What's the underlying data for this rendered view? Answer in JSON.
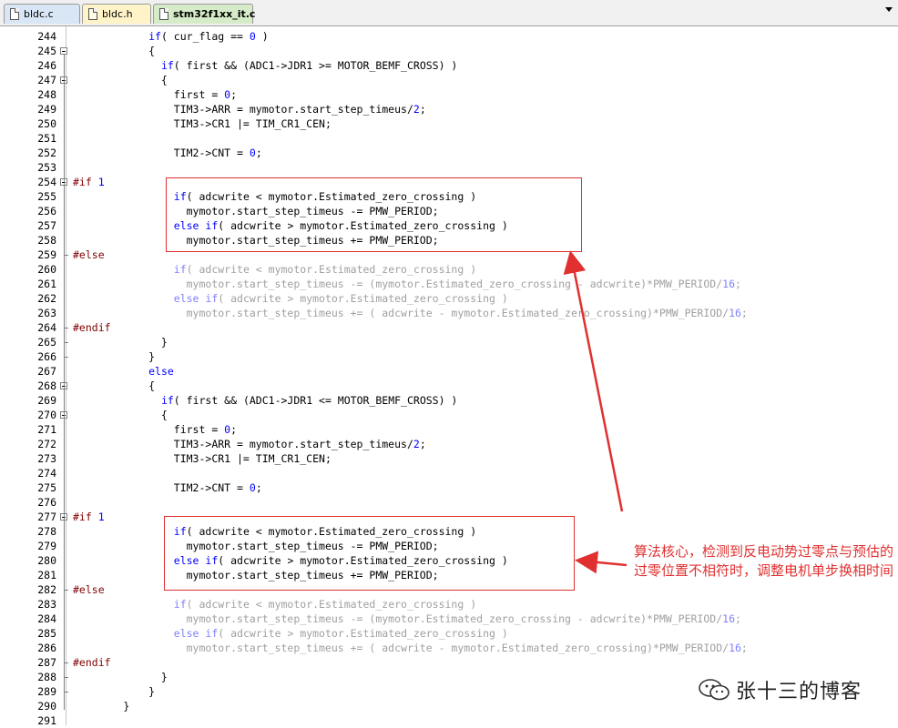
{
  "tabs": [
    {
      "label": "bldc.c",
      "active": false
    },
    {
      "label": "bldc.h",
      "active": false
    },
    {
      "label": "stm32f1xx_it.c",
      "active": true
    }
  ],
  "colors": {
    "keyword": "#0000ff",
    "preprocessor": "#800000",
    "inactive_code": "#a0a0a0",
    "annotation": "#e03030"
  },
  "lines": [
    {
      "n": "244",
      "text": "            if( cur_flag == 0 )"
    },
    {
      "n": "245",
      "text": "            {"
    },
    {
      "n": "246",
      "text": "              if( first && (ADC1->JDR1 >= MOTOR_BEMF_CROSS) )"
    },
    {
      "n": "247",
      "text": "              {"
    },
    {
      "n": "248",
      "text": "                first = 0;"
    },
    {
      "n": "249",
      "text": "                TIM3->ARR = mymotor.start_step_timeus/2;"
    },
    {
      "n": "250",
      "text": "                TIM3->CR1 |= TIM_CR1_CEN;"
    },
    {
      "n": "251",
      "text": ""
    },
    {
      "n": "252",
      "text": "                TIM2->CNT = 0;"
    },
    {
      "n": "253",
      "text": ""
    },
    {
      "n": "254",
      "text": "#if 1"
    },
    {
      "n": "255",
      "text": "                if( adcwrite < mymotor.Estimated_zero_crossing )"
    },
    {
      "n": "256",
      "text": "                  mymotor.start_step_timeus -= PMW_PERIOD;"
    },
    {
      "n": "257",
      "text": "                else if( adcwrite > mymotor.Estimated_zero_crossing )"
    },
    {
      "n": "258",
      "text": "                  mymotor.start_step_timeus += PMW_PERIOD;"
    },
    {
      "n": "259",
      "text": "#else"
    },
    {
      "n": "260",
      "text": "                if( adcwrite < mymotor.Estimated_zero_crossing )"
    },
    {
      "n": "261",
      "text": "                  mymotor.start_step_timeus -= (mymotor.Estimated_zero_crossing - adcwrite)*PMW_PERIOD/16;"
    },
    {
      "n": "262",
      "text": "                else if( adcwrite > mymotor.Estimated_zero_crossing )"
    },
    {
      "n": "263",
      "text": "                  mymotor.start_step_timeus += ( adcwrite - mymotor.Estimated_zero_crossing)*PMW_PERIOD/16;"
    },
    {
      "n": "264",
      "text": "#endif"
    },
    {
      "n": "265",
      "text": "              }"
    },
    {
      "n": "266",
      "text": "            }"
    },
    {
      "n": "267",
      "text": "            else"
    },
    {
      "n": "268",
      "text": "            {"
    },
    {
      "n": "269",
      "text": "              if( first && (ADC1->JDR1 <= MOTOR_BEMF_CROSS) )"
    },
    {
      "n": "270",
      "text": "              {"
    },
    {
      "n": "271",
      "text": "                first = 0;"
    },
    {
      "n": "272",
      "text": "                TIM3->ARR = mymotor.start_step_timeus/2;"
    },
    {
      "n": "273",
      "text": "                TIM3->CR1 |= TIM_CR1_CEN;"
    },
    {
      "n": "274",
      "text": ""
    },
    {
      "n": "275",
      "text": "                TIM2->CNT = 0;"
    },
    {
      "n": "276",
      "text": ""
    },
    {
      "n": "277",
      "text": "#if 1"
    },
    {
      "n": "278",
      "text": "                if( adcwrite < mymotor.Estimated_zero_crossing )"
    },
    {
      "n": "279",
      "text": "                  mymotor.start_step_timeus -= PMW_PERIOD;"
    },
    {
      "n": "280",
      "text": "                else if( adcwrite > mymotor.Estimated_zero_crossing )"
    },
    {
      "n": "281",
      "text": "                  mymotor.start_step_timeus += PMW_PERIOD;"
    },
    {
      "n": "282",
      "text": "#else"
    },
    {
      "n": "283",
      "text": "                if( adcwrite < mymotor.Estimated_zero_crossing )"
    },
    {
      "n": "284",
      "text": "                  mymotor.start_step_timeus -= (mymotor.Estimated_zero_crossing - adcwrite)*PMW_PERIOD/16;"
    },
    {
      "n": "285",
      "text": "                else if( adcwrite > mymotor.Estimated_zero_crossing )"
    },
    {
      "n": "286",
      "text": "                  mymotor.start_step_timeus += ( adcwrite - mymotor.Estimated_zero_crossing)*PMW_PERIOD/16;"
    },
    {
      "n": "287",
      "text": "#endif"
    },
    {
      "n": "288",
      "text": "              }"
    },
    {
      "n": "289",
      "text": "            }"
    },
    {
      "n": "290",
      "text": "        }"
    },
    {
      "n": "291",
      "text": ""
    }
  ],
  "annotation": {
    "text": "算法核心，检测到反电动势过零点与预估的过零位置不相符时，调整电机单步换相时间"
  },
  "watermark": {
    "text": "张十三的博客"
  }
}
